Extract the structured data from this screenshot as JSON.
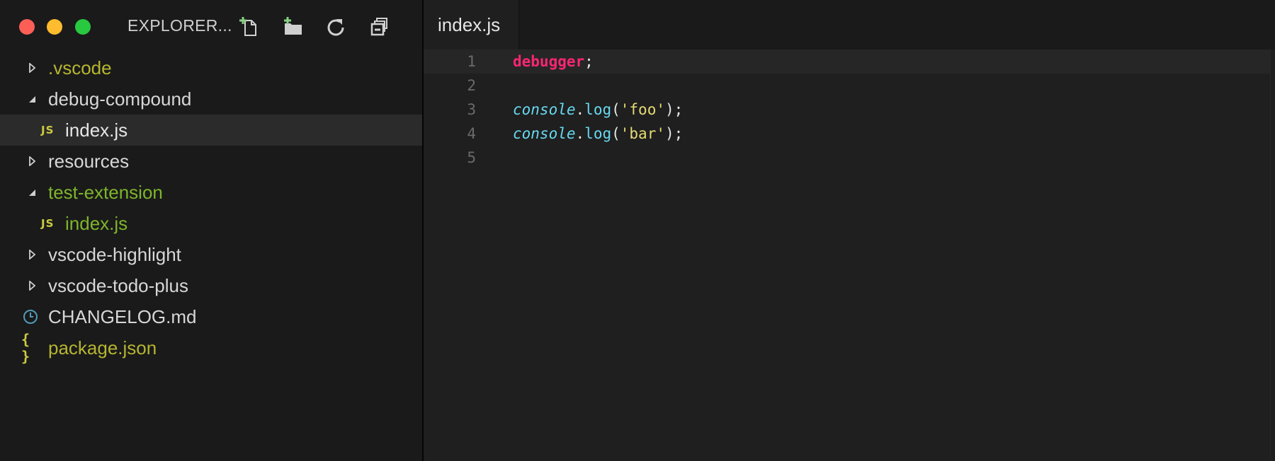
{
  "window": {
    "traffic_lights": [
      "close",
      "minimize",
      "maximize"
    ],
    "colors": {
      "close": "#fd5f57",
      "minimize": "#febc2e",
      "maximize": "#28c840"
    }
  },
  "sidebar": {
    "title": "EXPLORER...",
    "actions": [
      {
        "name": "new-file",
        "icon": "new-file-icon"
      },
      {
        "name": "new-folder",
        "icon": "new-folder-icon"
      },
      {
        "name": "refresh",
        "icon": "refresh-icon"
      },
      {
        "name": "collapse-all",
        "icon": "collapse-all-icon"
      }
    ],
    "tree": [
      {
        "label": ".vscode",
        "type": "folder",
        "expanded": false,
        "level": 0,
        "color": "#b5b531"
      },
      {
        "label": "debug-compound",
        "type": "folder",
        "expanded": true,
        "level": 0,
        "color": "#d7d7d7"
      },
      {
        "label": "index.js",
        "type": "file",
        "badge": "JS",
        "level": 1,
        "color": "#e6e6e6",
        "selected": true
      },
      {
        "label": "resources",
        "type": "folder",
        "expanded": false,
        "level": 0,
        "color": "#d7d7d7"
      },
      {
        "label": "test-extension",
        "type": "folder",
        "expanded": true,
        "level": 0,
        "color": "#7fb52b"
      },
      {
        "label": "index.js",
        "type": "file",
        "badge": "JS",
        "level": 1,
        "color": "#7fb52b"
      },
      {
        "label": "vscode-highlight",
        "type": "folder",
        "expanded": false,
        "level": 0,
        "color": "#d7d7d7"
      },
      {
        "label": "vscode-todo-plus",
        "type": "folder",
        "expanded": false,
        "level": 0,
        "color": "#d7d7d7"
      },
      {
        "label": "CHANGELOG.md",
        "type": "file",
        "icon": "clock-icon",
        "level": 0,
        "color": "#d7d7d7"
      },
      {
        "label": "package.json",
        "type": "file",
        "icon": "braces-icon",
        "badge": "{ }",
        "level": 0,
        "color": "#b5b531"
      }
    ]
  },
  "editor": {
    "tabs": [
      {
        "label": "index.js",
        "active": true
      }
    ],
    "lines": [
      {
        "number": "1",
        "tokens": [
          {
            "t": "debugger",
            "k": "kw"
          },
          {
            "t": ";",
            "k": "punc"
          }
        ]
      },
      {
        "number": "2",
        "tokens": []
      },
      {
        "number": "3",
        "tokens": [
          {
            "t": "console",
            "k": "obj"
          },
          {
            "t": ".",
            "k": "punc"
          },
          {
            "t": "log",
            "k": "fn"
          },
          {
            "t": "(",
            "k": "punc"
          },
          {
            "t": "'foo'",
            "k": "str"
          },
          {
            "t": ");",
            "k": "punc"
          }
        ]
      },
      {
        "number": "4",
        "tokens": [
          {
            "t": "console",
            "k": "obj"
          },
          {
            "t": ".",
            "k": "punc"
          },
          {
            "t": "log",
            "k": "fn"
          },
          {
            "t": "(",
            "k": "punc"
          },
          {
            "t": "'bar'",
            "k": "str"
          },
          {
            "t": ");",
            "k": "punc"
          }
        ]
      },
      {
        "number": "5",
        "tokens": []
      }
    ],
    "current_line": "1"
  }
}
